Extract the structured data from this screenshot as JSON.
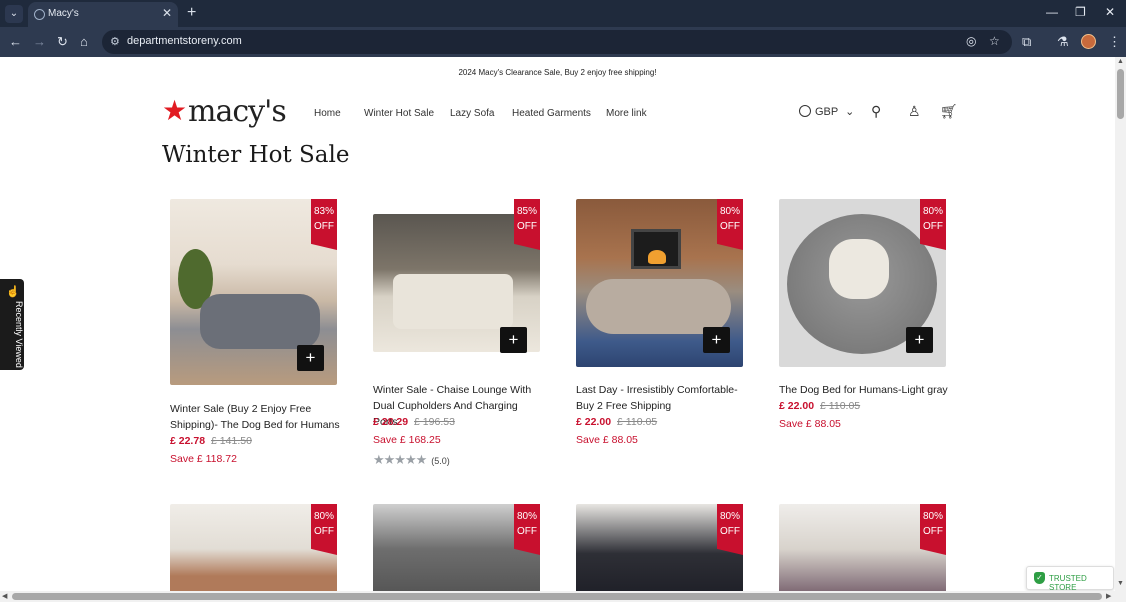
{
  "browser": {
    "tab_title": "Macy's",
    "url": "departmentstoreny.com",
    "new_tab": "+",
    "tab_close": "✕"
  },
  "site": {
    "announcement": "2024 Macy's Clearance Sale, Buy 2 enjoy free shipping!",
    "logo_text": "macy's",
    "brand_color": "#e11b22",
    "sale_color": "#c8102e",
    "nav": [
      "Home",
      "Winter Hot Sale",
      "Lazy Sofa",
      "Heated Garments",
      "More link"
    ],
    "currency": "GBP",
    "section_title": "Winter Hot Sale",
    "recently_viewed": "Recently Viewed",
    "trusted_store": "TRUSTED STORE"
  },
  "products": [
    {
      "badge_pct": "83%",
      "badge_off": "OFF",
      "title": "Winter Sale (Buy 2 Enjoy Free Shipping)- The Dog Bed for Humans",
      "price": "£ 22.78",
      "old_price": "£ 141.50",
      "save": "Save £ 118.72"
    },
    {
      "badge_pct": "85%",
      "badge_off": "OFF",
      "title": "Winter Sale - Chaise Lounge With Dual Cupholders And Charging Ports",
      "price": "£ 28.29",
      "old_price": "£ 196.53",
      "save": "Save £ 168.25",
      "rating_stars": "★★★★★",
      "rating_value": "(5.0)"
    },
    {
      "badge_pct": "80%",
      "badge_off": "OFF",
      "title": "Last Day - Irresistibly Comfortable-Buy 2 Free Shipping",
      "price": "£ 22.00",
      "old_price": "£ 110.05",
      "save": "Save £ 88.05"
    },
    {
      "badge_pct": "80%",
      "badge_off": "OFF",
      "title": "The Dog Bed for Humans-Light gray",
      "price": "£ 22.00",
      "old_price": "£ 110.05",
      "save": "Save £ 88.05"
    },
    {
      "badge_pct": "80%",
      "badge_off": "OFF"
    },
    {
      "badge_pct": "80%",
      "badge_off": "OFF"
    },
    {
      "badge_pct": "80%",
      "badge_off": "OFF"
    },
    {
      "badge_pct": "80%",
      "badge_off": "OFF"
    }
  ]
}
